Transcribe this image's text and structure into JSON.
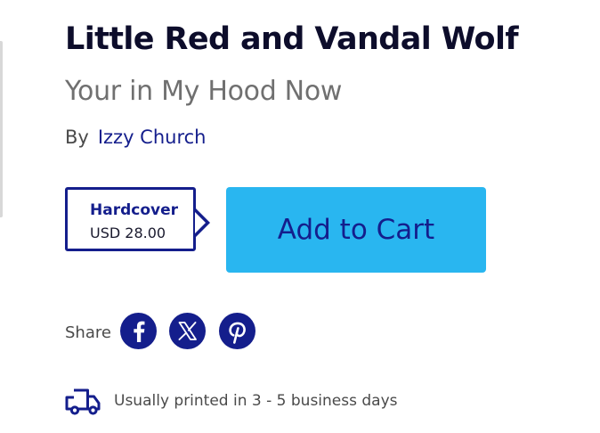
{
  "product": {
    "title": "Little Red and Vandal Wolf",
    "subtitle": "Your in My Hood Now",
    "by_label": "By",
    "author": "Izzy Church"
  },
  "format": {
    "name": "Hardcover",
    "price": "USD 28.00"
  },
  "cart": {
    "add_label": "Add to Cart"
  },
  "share": {
    "label": "Share",
    "networks": [
      {
        "name": "Facebook",
        "icon": "facebook-icon"
      },
      {
        "name": "X",
        "icon": "x-icon"
      },
      {
        "name": "Pinterest",
        "icon": "pinterest-icon"
      }
    ]
  },
  "shipping": {
    "icon": "truck-icon",
    "text": "Usually printed in 3 - 5 business days"
  },
  "colors": {
    "navy": "#141e8c",
    "cart_button": "#29b6f0",
    "muted_text": "#707070"
  }
}
